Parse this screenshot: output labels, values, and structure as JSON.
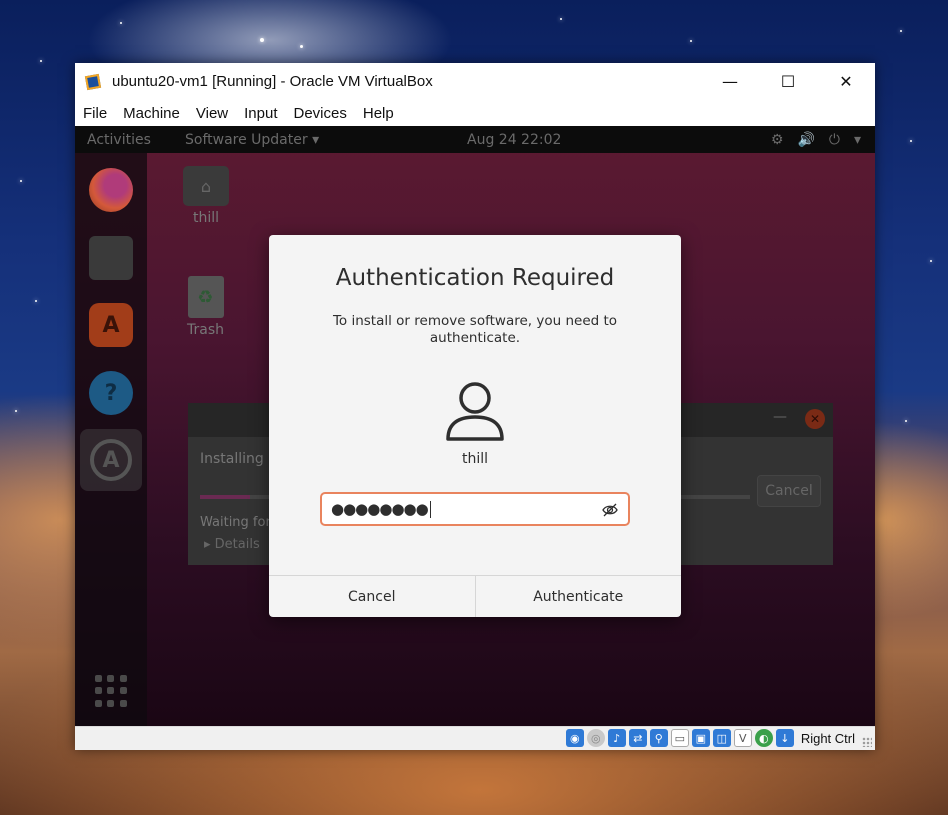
{
  "vbox": {
    "title": "ubuntu20-vm1 [Running] - Oracle VM VirtualBox",
    "controls": {
      "minimize": "—",
      "maximize": "☐",
      "close": "✕"
    },
    "menu": [
      "File",
      "Machine",
      "View",
      "Input",
      "Devices",
      "Help"
    ],
    "host_key": "Right Ctrl"
  },
  "ubuntu": {
    "topbar": {
      "activities": "Activities",
      "app_menu": "Software Updater ▾",
      "clock": "Aug 24  22:02",
      "tray": [
        "⚙",
        "🔊",
        "⏻",
        "▾"
      ]
    },
    "desktop": {
      "home_label": "thill",
      "trash_label": "Trash"
    },
    "updater": {
      "installing_text": "Installing u",
      "waiting_text": "Waiting for",
      "details_text": "▸ Details",
      "cancel_label": "Cancel",
      "progress_fraction": 0.09
    }
  },
  "auth_dialog": {
    "title": "Authentication Required",
    "message": "To install or remove software, you need to authenticate.",
    "user": "thill",
    "password_mask": "●●●●●●●●",
    "cancel_label": "Cancel",
    "authenticate_label": "Authenticate",
    "focus_color": "#e9845e"
  }
}
